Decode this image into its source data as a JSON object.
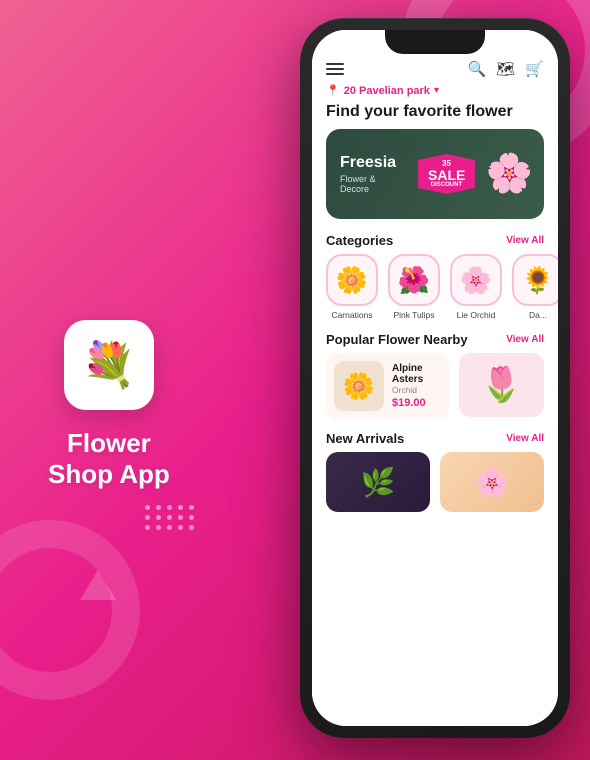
{
  "app": {
    "title": "Flower",
    "title2": "Shop App",
    "icon": "💐"
  },
  "background": {
    "color": "#e91e8c"
  },
  "phone": {
    "header": {
      "menu_label": "menu",
      "search_label": "search",
      "map_label": "map",
      "cart_label": "cart"
    },
    "location": {
      "pin": "📍",
      "text": "20 Pavelian park",
      "chevron": "▾"
    },
    "page_title": "Find your favorite flower",
    "banner": {
      "title": "Freesia",
      "subtitle": "Flower & Decore",
      "sale_number": "35",
      "sale_word": "SALE",
      "sale_sub": "DISCOUNT",
      "icon": "🌸"
    },
    "categories": {
      "title": "Categories",
      "view_all": "View All",
      "items": [
        {
          "label": "Carnations",
          "icon": "🌼"
        },
        {
          "label": "Pink Tulips",
          "icon": "🌺"
        },
        {
          "label": "Lie Orchid",
          "icon": "🌸"
        },
        {
          "label": "Da...",
          "icon": "🌻"
        }
      ]
    },
    "popular": {
      "title": "Popular Flower Nearby",
      "view_all": "View All",
      "card": {
        "name": "Alpine Asters",
        "type": "Orchid",
        "price": "$19.00",
        "icon": "🌼"
      },
      "card_right_icon": "🌷"
    },
    "new_arrivals": {
      "title": "New Arrivals",
      "view_all": "View All",
      "card_left_icon": "🌿",
      "card_right_icon": "🌸"
    }
  }
}
